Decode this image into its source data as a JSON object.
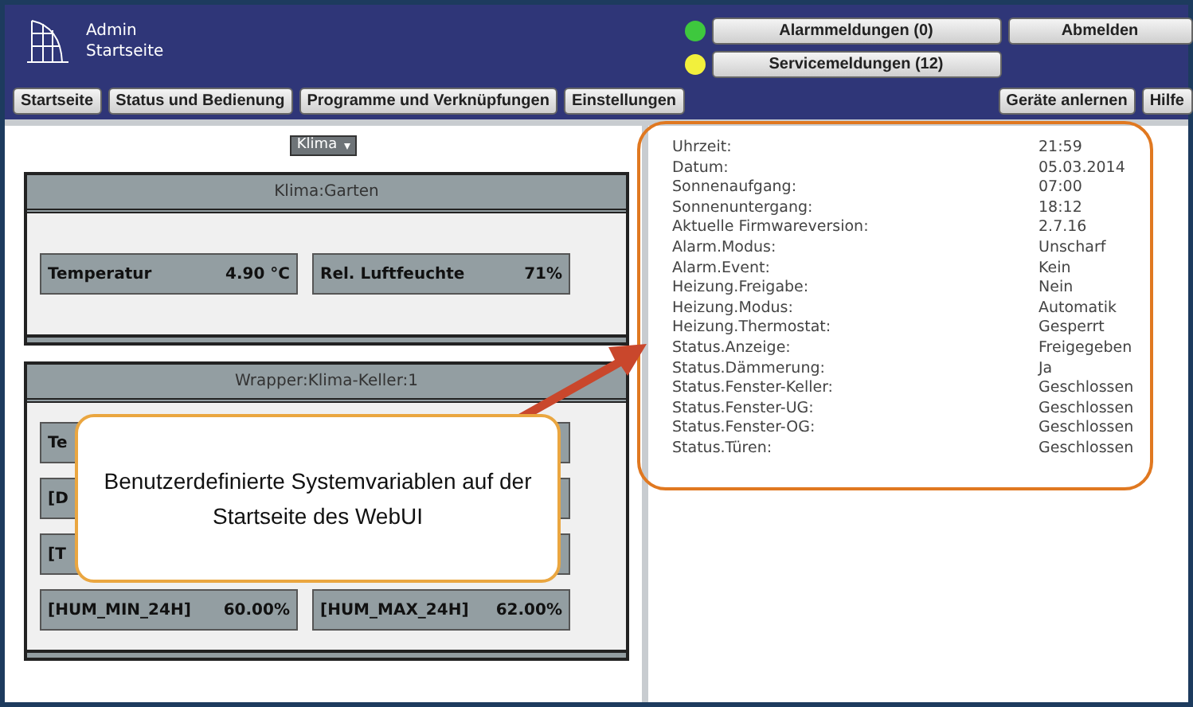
{
  "header": {
    "user": "Admin",
    "page": "Startseite",
    "nav_buttons": [
      "Startseite",
      "Status und Bedienung",
      "Programme und Verknüpfungen",
      "Einstellungen"
    ],
    "messages": [
      {
        "label": "Alarmmeldungen (0)",
        "color": "#3ec83e"
      },
      {
        "label": "Servicemeldungen (12)",
        "color": "#f2f03c"
      }
    ],
    "logout": "Abmelden",
    "right_buttons": [
      "Geräte anlernen",
      "Hilfe"
    ]
  },
  "left": {
    "dropdown": "Klima",
    "groups": [
      {
        "title": "Klima:Garten",
        "tiles": [
          {
            "kind": "reading",
            "label": "Temperatur",
            "value": "4.90 °C"
          },
          {
            "kind": "reading",
            "label": "Rel. Luftfeuchte",
            "value": "71%"
          }
        ]
      },
      {
        "title": "Wrapper:Klima-Keller:1",
        "tiles": [
          {
            "kind": "reading",
            "label": "Te"
          },
          {
            "kind": "covered"
          },
          {
            "kind": "reading",
            "label": "[D"
          },
          {
            "kind": "covered"
          },
          {
            "kind": "reading",
            "label": "[T"
          },
          {
            "kind": "covered"
          },
          {
            "kind": "reading",
            "label": "[HUM_MIN_24H]",
            "value": "60.00%"
          },
          {
            "kind": "reading",
            "label": "[HUM_MAX_24H]",
            "value": "62.00%"
          }
        ]
      }
    ]
  },
  "variables": [
    {
      "name": "Uhrzeit:",
      "value": "21:59"
    },
    {
      "name": "Datum:",
      "value": "05.03.2014"
    },
    {
      "name": "Sonnenaufgang:",
      "value": "07:00"
    },
    {
      "name": "Sonnenuntergang:",
      "value": "18:12"
    },
    {
      "name": "Aktuelle Firmwareversion:",
      "value": "2.7.16"
    },
    {
      "name": "Alarm.Modus:",
      "value": "Unscharf"
    },
    {
      "name": "Alarm.Event:",
      "value": "Kein"
    },
    {
      "name": "Heizung.Freigabe:",
      "value": "Nein"
    },
    {
      "name": "Heizung.Modus:",
      "value": "Automatik"
    },
    {
      "name": "Heizung.Thermostat:",
      "value": "Gesperrt"
    },
    {
      "name": "Status.Anzeige:",
      "value": "Freigegeben"
    },
    {
      "name": "Status.Dämmerung:",
      "value": "Ja"
    },
    {
      "name": "Status.Fenster-Keller:",
      "value": "Geschlossen"
    },
    {
      "name": "Status.Fenster-UG:",
      "value": "Geschlossen"
    },
    {
      "name": "Status.Fenster-OG:",
      "value": "Geschlossen"
    },
    {
      "name": "Status.Türen:",
      "value": "Geschlossen"
    }
  ],
  "annotation": "Benutzerdefinierte Systemvariablen auf der Startseite des WebUI"
}
